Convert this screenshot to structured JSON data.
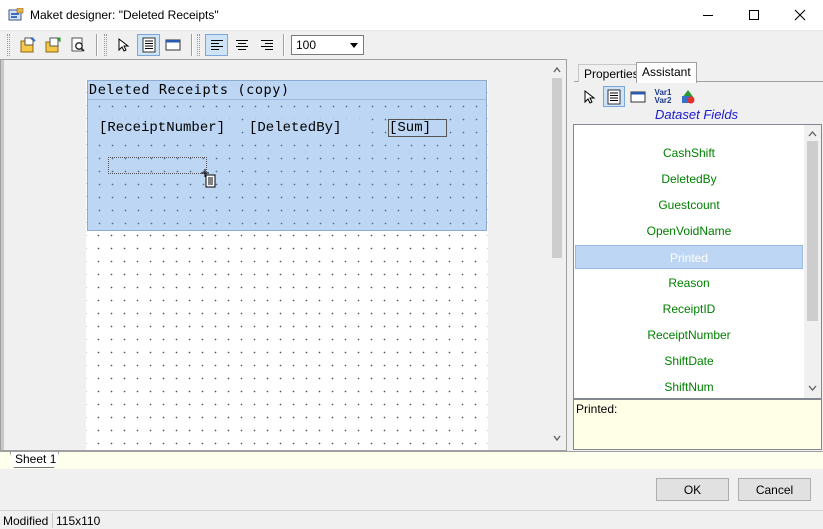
{
  "window": {
    "title": "Maket designer: \"Deleted Receipts\""
  },
  "toolbar": {
    "zoom_value": "100"
  },
  "report": {
    "band_title": "Deleted Receipts (copy)",
    "fields": [
      "[ReceiptNumber]",
      "[DeletedBy]",
      "[Sum]"
    ]
  },
  "panel": {
    "tabs": [
      "Properties",
      "Assistant"
    ],
    "active_tab": "Assistant",
    "var_icon_label_1": "Var1",
    "var_icon_label_2": "Var2",
    "dataset_fields_label": "Dataset Fields",
    "fields": [
      "CashShift",
      "DeletedBy",
      "Guestcount",
      "OpenVoidName",
      "Printed",
      "Reason",
      "ReceiptID",
      "ReceiptNumber",
      "ShiftDate",
      "ShiftNum"
    ],
    "selected_field": "Printed",
    "info_text": "Printed:"
  },
  "sheets": [
    "Sheet 1"
  ],
  "buttons": {
    "ok": "OK",
    "cancel": "Cancel"
  },
  "status": {
    "state": "Modified",
    "size": "115x110"
  },
  "colors": {
    "band_fill": "#bcd6f3",
    "field_text_green": "#008000",
    "dataset_label_blue": "#1a1ad0",
    "info_bg": "#ffffe7"
  }
}
